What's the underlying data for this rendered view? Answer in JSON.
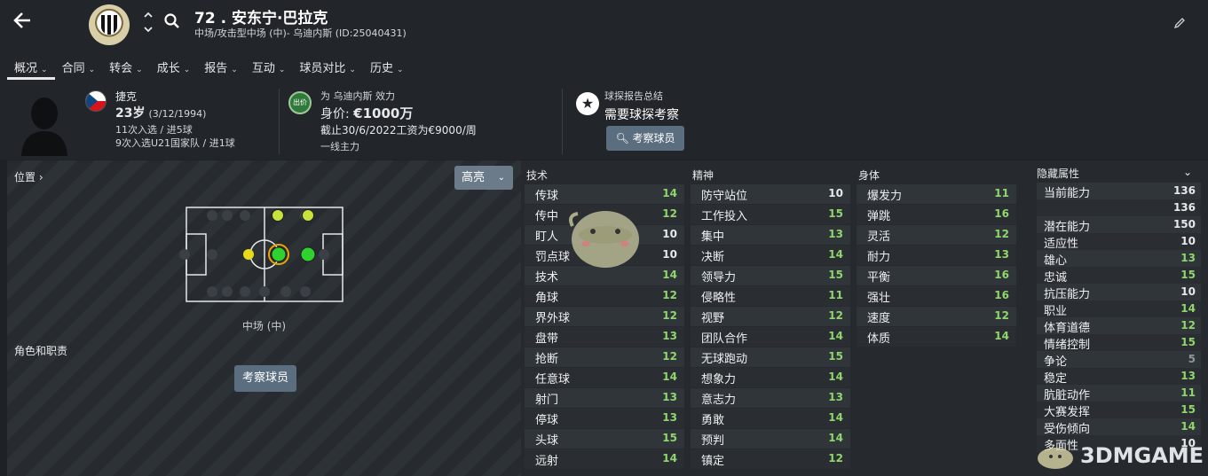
{
  "header": {
    "title": "72 . 安东宁·巴拉克",
    "subtitle": "中场/攻击型中场 (中)- 乌迪内斯 (ID:25040431)"
  },
  "tabs": [
    {
      "label": "概况"
    },
    {
      "label": "合同"
    },
    {
      "label": "转会"
    },
    {
      "label": "成长"
    },
    {
      "label": "报告"
    },
    {
      "label": "互动"
    },
    {
      "label": "球员对比"
    },
    {
      "label": "历史"
    }
  ],
  "profile": {
    "nation": "捷克",
    "age": "23岁",
    "dob": "(3/12/1994)",
    "caps": "11次入选 / 进5球",
    "u21_caps": "9次入选U21国家队 / 进1球"
  },
  "contract": {
    "badge": "出价",
    "club": "为 乌迪内斯 效力",
    "value_label": "身价: ",
    "value": "€1000万",
    "wage": "截止30/6/2022工资为€9000/周",
    "role": "一线主力"
  },
  "scout": {
    "heading": "球探报告总结",
    "text": "需要球探考察",
    "button": "考察球员"
  },
  "left_panel": {
    "position_label": "位置 ›",
    "highlight_button": "高亮",
    "position_name": "中场 (中)",
    "roles_label": "角色和职责",
    "scout_button": "考察球员"
  },
  "technical": {
    "heading": "技术",
    "rows": [
      {
        "name": "传球",
        "value": "14"
      },
      {
        "name": "传中",
        "value": "12"
      },
      {
        "name": "盯人",
        "value": "10"
      },
      {
        "name": "罚点球",
        "value": "10"
      },
      {
        "name": "技术",
        "value": "14"
      },
      {
        "name": "角球",
        "value": "12"
      },
      {
        "name": "界外球",
        "value": "12"
      },
      {
        "name": "盘带",
        "value": "13"
      },
      {
        "name": "抢断",
        "value": "12"
      },
      {
        "name": "任意球",
        "value": "14"
      },
      {
        "name": "射门",
        "value": "13"
      },
      {
        "name": "停球",
        "value": "13"
      },
      {
        "name": "头球",
        "value": "15"
      },
      {
        "name": "远射",
        "value": "14"
      }
    ]
  },
  "mental": {
    "heading": "精神",
    "rows": [
      {
        "name": "防守站位",
        "value": "10"
      },
      {
        "name": "工作投入",
        "value": "15"
      },
      {
        "name": "集中",
        "value": "13"
      },
      {
        "name": "决断",
        "value": "14"
      },
      {
        "name": "领导力",
        "value": "15"
      },
      {
        "name": "侵略性",
        "value": "11"
      },
      {
        "name": "视野",
        "value": "12"
      },
      {
        "name": "团队合作",
        "value": "14"
      },
      {
        "name": "无球跑动",
        "value": "15"
      },
      {
        "name": "想象力",
        "value": "14"
      },
      {
        "name": "意志力",
        "value": "13"
      },
      {
        "name": "勇敢",
        "value": "14"
      },
      {
        "name": "预判",
        "value": "14"
      },
      {
        "name": "镇定",
        "value": "12"
      }
    ]
  },
  "physical": {
    "heading": "身体",
    "rows": [
      {
        "name": "爆发力",
        "value": "11"
      },
      {
        "name": "弹跳",
        "value": "16"
      },
      {
        "name": "灵活",
        "value": "12"
      },
      {
        "name": "耐力",
        "value": "13"
      },
      {
        "name": "平衡",
        "value": "16"
      },
      {
        "name": "强壮",
        "value": "16"
      },
      {
        "name": "速度",
        "value": "12"
      },
      {
        "name": "体质",
        "value": "14"
      }
    ]
  },
  "hidden": {
    "heading": "隐藏属性",
    "rows": [
      {
        "name": "当前能力",
        "value": "136"
      },
      {
        "name": "",
        "value": "136"
      },
      {
        "name": "潜在能力",
        "value": "150"
      },
      {
        "name": "适应性",
        "value": "10"
      },
      {
        "name": "雄心",
        "value": "13"
      },
      {
        "name": "忠诚",
        "value": "15"
      },
      {
        "name": "抗压能力",
        "value": "10"
      },
      {
        "name": "职业",
        "value": "14"
      },
      {
        "name": "体育道德",
        "value": "12"
      },
      {
        "name": "情绪控制",
        "value": "15"
      },
      {
        "name": "争论",
        "value": "5"
      },
      {
        "name": "稳定",
        "value": "13"
      },
      {
        "name": "肮脏动作",
        "value": "11"
      },
      {
        "name": "大赛发挥",
        "value": "15"
      },
      {
        "name": "受伤倾向",
        "value": "14"
      },
      {
        "name": "多面性",
        "value": "10"
      }
    ]
  },
  "watermark": "3DMGAME",
  "colors": {
    "good": "#8fd66c",
    "neutral": "#e6e8ea",
    "dim": "#8f969c",
    "button": "#5a6e80",
    "natural_position": "#2fd12f",
    "accomplished_position": "#d8e84a"
  }
}
